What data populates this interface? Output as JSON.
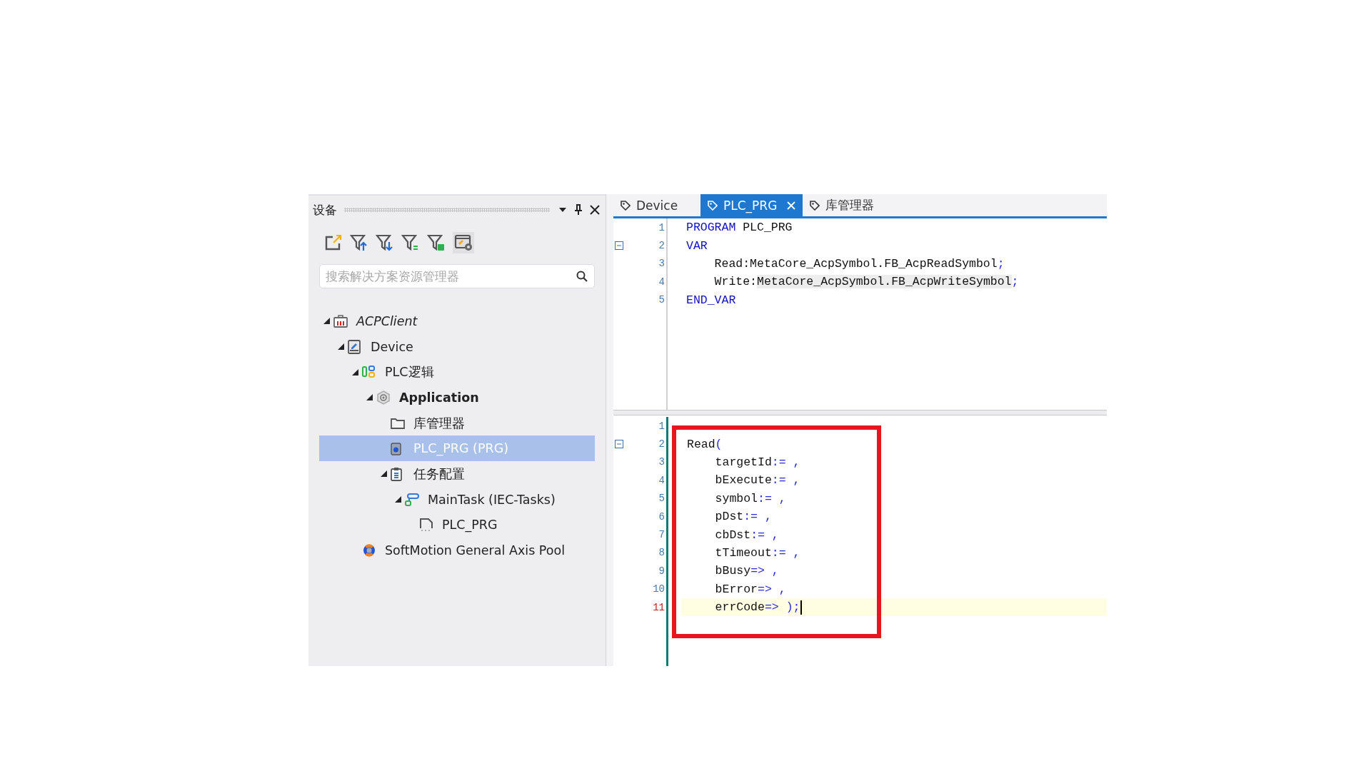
{
  "panel": {
    "title": "设备",
    "search": {
      "placeholder": "搜索解决方案资源管理器"
    },
    "tree": [
      {
        "label": "ACPClient",
        "kind": "project",
        "italic": true,
        "selected": false,
        "expanded": true,
        "children": [
          {
            "label": "Device",
            "kind": "device",
            "selected": false,
            "expanded": true,
            "children": [
              {
                "label": "PLC逻辑",
                "kind": "plc-logic",
                "selected": false,
                "expanded": true,
                "children": [
                  {
                    "label": "Application",
                    "kind": "application",
                    "bold": true,
                    "selected": false,
                    "expanded": true,
                    "children": [
                      {
                        "label": "库管理器",
                        "kind": "library",
                        "selected": false
                      },
                      {
                        "label": "PLC_PRG (PRG)",
                        "kind": "program",
                        "selected": true
                      },
                      {
                        "label": "任务配置",
                        "kind": "task-config",
                        "selected": false,
                        "expanded": true,
                        "children": [
                          {
                            "label": "MainTask (IEC-Tasks)",
                            "kind": "task",
                            "selected": false,
                            "expanded": true,
                            "children": [
                              {
                                "label": "PLC_PRG",
                                "kind": "program-call",
                                "selected": false
                              }
                            ]
                          }
                        ]
                      }
                    ]
                  }
                ]
              },
              {
                "label": "SoftMotion General Axis Pool",
                "kind": "axis-pool",
                "selected": false
              }
            ]
          }
        ]
      }
    ]
  },
  "editor": {
    "tabs": [
      {
        "label": "Device",
        "selected": false,
        "closable": false
      },
      {
        "label": "PLC_PRG",
        "selected": true,
        "closable": true
      },
      {
        "label": "库管理器",
        "selected": false,
        "closable": false
      }
    ],
    "declaration": [
      {
        "number": "1",
        "fold": false,
        "current": false,
        "tokens": [
          {
            "text": "PROGRAM",
            "kind": "keyword"
          },
          {
            "text": " PLC_PRG",
            "kind": "plain"
          }
        ]
      },
      {
        "number": "2",
        "fold": true,
        "current": false,
        "tokens": [
          {
            "text": "VAR",
            "kind": "keyword"
          }
        ]
      },
      {
        "number": "3",
        "fold": false,
        "current": false,
        "tokens": [
          {
            "text": "    Read:MetaCore_AcpSymbol.FB_AcpReadSymbol",
            "kind": "plain"
          },
          {
            "text": ";",
            "kind": "operator"
          }
        ]
      },
      {
        "number": "4",
        "fold": false,
        "current": false,
        "tokens": [
          {
            "text": "    Write:",
            "kind": "plain"
          },
          {
            "text": "MetaCore_AcpSymbol.FB_AcpWriteSymbol",
            "kind": "match"
          },
          {
            "text": ";",
            "kind": "operator"
          }
        ]
      },
      {
        "number": "5",
        "fold": false,
        "current": false,
        "tokens": [
          {
            "text": "END_VAR",
            "kind": "keyword"
          }
        ]
      }
    ],
    "implementation": [
      {
        "number": "1",
        "fold": false,
        "current": false
      },
      {
        "number": "2",
        "fold": true,
        "current": false,
        "tokens": [
          {
            "text": "Read",
            "kind": "plain"
          },
          {
            "text": "(",
            "kind": "operator"
          }
        ]
      },
      {
        "number": "3",
        "fold": false,
        "current": false,
        "tokens": [
          {
            "text": "    targetId",
            "kind": "plain"
          },
          {
            "text": ":= ,",
            "kind": "operator"
          }
        ]
      },
      {
        "number": "4",
        "fold": false,
        "current": false,
        "tokens": [
          {
            "text": "    bExecute",
            "kind": "plain"
          },
          {
            "text": ":= ,",
            "kind": "operator"
          }
        ]
      },
      {
        "number": "5",
        "fold": false,
        "current": false,
        "tokens": [
          {
            "text": "    symbol",
            "kind": "plain"
          },
          {
            "text": ":= ,",
            "kind": "operator"
          }
        ]
      },
      {
        "number": "6",
        "fold": false,
        "current": false,
        "tokens": [
          {
            "text": "    pDst",
            "kind": "plain"
          },
          {
            "text": ":= ,",
            "kind": "operator"
          }
        ]
      },
      {
        "number": "7",
        "fold": false,
        "current": false,
        "tokens": [
          {
            "text": "    cbDst",
            "kind": "plain"
          },
          {
            "text": ":= ,",
            "kind": "operator"
          }
        ]
      },
      {
        "number": "8",
        "fold": false,
        "current": false,
        "tokens": [
          {
            "text": "    tTimeout",
            "kind": "plain"
          },
          {
            "text": ":= ,",
            "kind": "operator"
          }
        ]
      },
      {
        "number": "9",
        "fold": false,
        "current": false,
        "tokens": [
          {
            "text": "    bBusy",
            "kind": "plain"
          },
          {
            "text": "=> ,",
            "kind": "operator"
          }
        ]
      },
      {
        "number": "10",
        "fold": false,
        "current": false,
        "tokens": [
          {
            "text": "    bError",
            "kind": "plain"
          },
          {
            "text": "=> ,",
            "kind": "operator"
          }
        ]
      },
      {
        "number": "11",
        "fold": false,
        "current": true,
        "tokens": [
          {
            "text": "    errCode",
            "kind": "plain"
          },
          {
            "text": "=> );",
            "kind": "operator"
          }
        ]
      }
    ]
  }
}
